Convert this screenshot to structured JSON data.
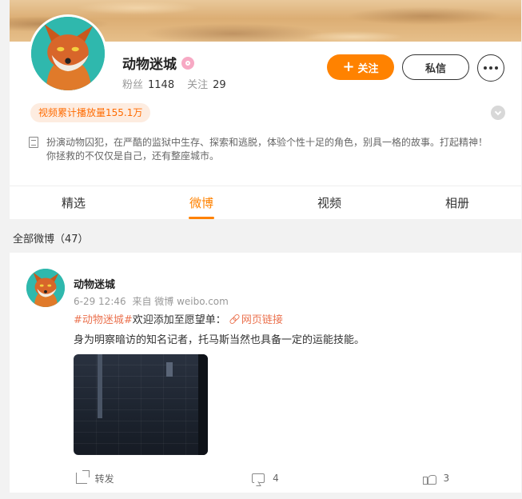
{
  "profile": {
    "name": "动物迷城",
    "followers_label": "粉丝",
    "followers_value": "1148",
    "following_label": "关注",
    "following_value": "29",
    "follow_button": "关注",
    "message_button": "私信",
    "views_tag": "视频累计播放量155.1万",
    "bio_line1": "扮演动物囚犯，在严酷的监狱中生存、探索和逃脱，体验个性十足的角色，别具一格的故事。打起精神！",
    "bio_line2": "你拯救的不仅仅是自己，还有整座城市。"
  },
  "tabs": [
    {
      "label": "精选"
    },
    {
      "label": "微博"
    },
    {
      "label": "视频"
    },
    {
      "label": "相册"
    }
  ],
  "feed": {
    "header": "全部微博（47）"
  },
  "post": {
    "author": "动物迷城",
    "time": "6-29 12:46",
    "source": "来自 微博 weibo.com",
    "hashtag": "#动物迷城#",
    "text1": " 欢迎添加至愿望单：",
    "link_text": "网页链接",
    "text2": "身为明察暗访的知名记者，托马斯当然也具备一定的运能技能。",
    "share_label": "转发",
    "comment_count": "4",
    "like_count": "3"
  },
  "colors": {
    "accent": "#ff8200",
    "link": "#eb7350"
  }
}
